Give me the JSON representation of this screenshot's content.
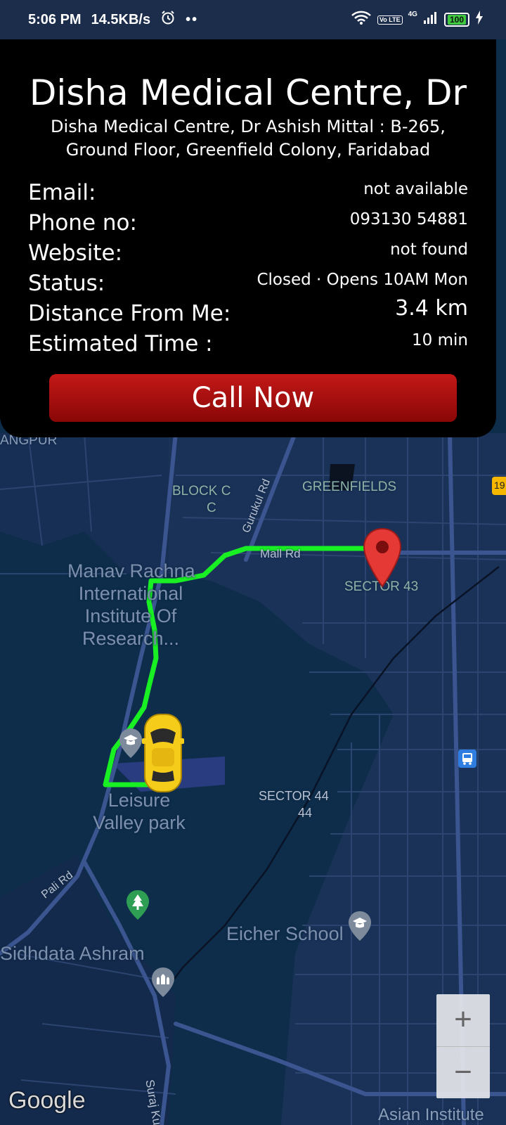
{
  "status_bar": {
    "time": "5:06 PM",
    "speed": "14.5KB/s",
    "dots": "••",
    "battery": "100",
    "network": "4G",
    "volte": "Vo LTE"
  },
  "place": {
    "title": "Disha Medical Centre, Dr",
    "address": "Disha Medical Centre, Dr Ashish Mittal : B-265, Ground Floor, Greenfield Colony, Faridabad",
    "rows": [
      {
        "label": "Email:",
        "value": "not available"
      },
      {
        "label": "Phone no:",
        "value": "093130 54881"
      },
      {
        "label": "Website:",
        "value": "not found"
      },
      {
        "label": "Status:",
        "value": "Closed · Opens 10AM Mon"
      },
      {
        "label": "Distance From Me:",
        "value": "3.4 km"
      },
      {
        "label": "Estimated Time :",
        "value": "10 min"
      }
    ],
    "call_button": "Call Now"
  },
  "map": {
    "labels": {
      "angpur": "ANGPUR",
      "block_c": "BLOCK C",
      "block_c2": "C",
      "greenfields": "GREENFIELDS",
      "gurukul_rd": "Gurukul Rd",
      "mall_rd": "Mall Rd",
      "sector_43": "SECTOR 43",
      "manav_rachna": "Manav Rachna\nInternational\nInstitute Of\nResearch...",
      "leisure_valley": "Leisure\nValley park",
      "sector_44": "SECTOR 44",
      "sector_44_num": "44",
      "pali_rd": "Pali Rd",
      "eicher_school": "Eicher School",
      "sidhdata_ashram": "Sidhdata Ashram",
      "suraj_kund": "Suraj Ku",
      "asian_institute": "Asian Institute",
      "road_badge": "19"
    },
    "zoom_in": "+",
    "zoom_out": "−",
    "attribution": "Google",
    "colors": {
      "route": "#19f024",
      "background": "#0d2d4a",
      "marker": "#e53935",
      "car": "#f6cc1b"
    }
  }
}
